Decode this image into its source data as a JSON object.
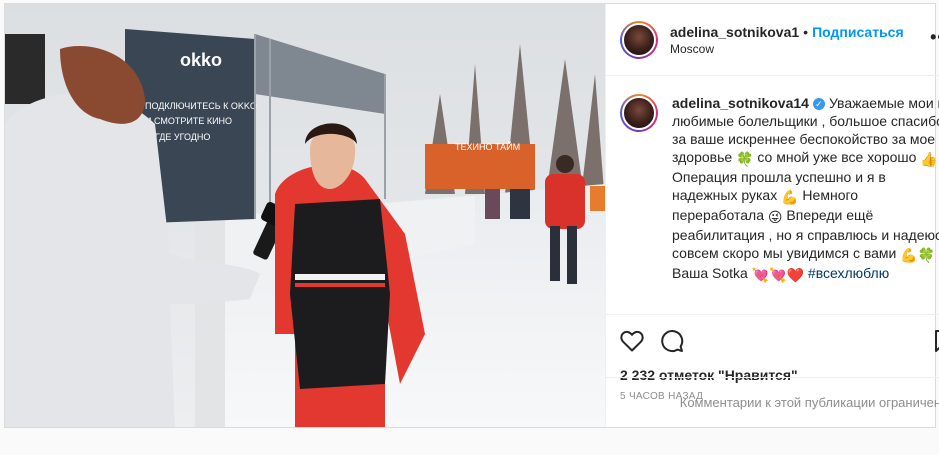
{
  "post": {
    "author": "adelina_sotnikova1",
    "dot": "•",
    "follow_label": "Подписаться",
    "location": "Moscow",
    "more_label": "•••"
  },
  "caption": {
    "author": "adelina_sotnikova14",
    "verified_mark": "✓",
    "segments": [
      "Уважаемые мои и любимые болельщики , большое спасибо за ваше искреннее беспокойство за мое здоровье ",
      " со мной уже все хорошо ",
      " Операция прошла успешно и я в надежных руках ",
      " Немного переработала ",
      " Впереди ещё реабилитация , но я справлюсь и надеюсь совсем скоро мы увидимся с вами ",
      " Ваша Sotka ",
      " #всехлюблю"
    ],
    "emojis": [
      "🍀",
      "👍",
      "💪",
      "😜",
      "💪🍀",
      "💘💘❤️"
    ]
  },
  "image": {
    "sign_brand": "okko",
    "sign_lines": [
      "ПОДКЛЮЧИТЕСЬ К OKKO",
      "И СМОТРИТЕ КИНО",
      "ГДЕ УГОДНО"
    ],
    "booth_sign": "ТЕХИНО ТАЙМ"
  },
  "likes_text": "2 232 отметок \"Нравится\"",
  "time_text": "5 часов назад",
  "comments_limited": "Комментарии к этой публикации ограничены.",
  "colors": {
    "accent": "#0095f6",
    "text": "#262626",
    "muted": "#8e8e8e"
  }
}
